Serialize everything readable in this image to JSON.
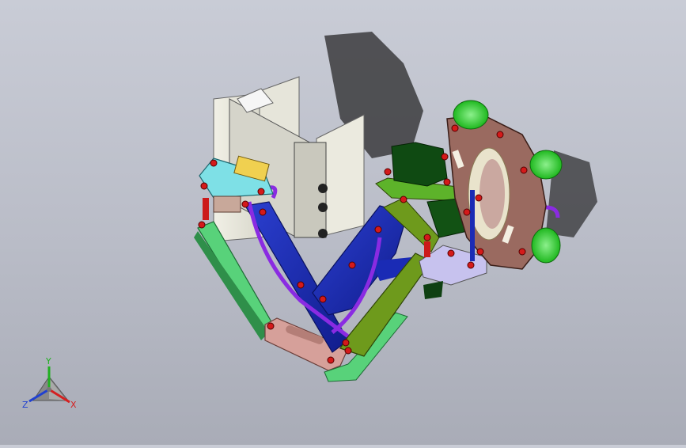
{
  "viewport": {
    "name": "3d-cad-viewport",
    "background_top": "#c9ccd6",
    "background_bottom": "#a9acb7"
  },
  "triad": {
    "x_label": "X",
    "y_label": "Y",
    "z_label": "Z",
    "x_color": "#d42020",
    "y_color": "#20b020",
    "z_color": "#2040d0"
  },
  "model": {
    "colors": {
      "blue_arm": "#1a2bb5",
      "green_link": "#58d27a",
      "olive_link": "#6e9a1c",
      "pink_link": "#d6a09a",
      "cyan_plate": "#7ee0e6",
      "flange": "#9a6a60",
      "green_pads": "#37d437",
      "purple_cable": "#8a2be2",
      "shadow": "#3a3a3a",
      "panel": "#ecebe0"
    }
  }
}
